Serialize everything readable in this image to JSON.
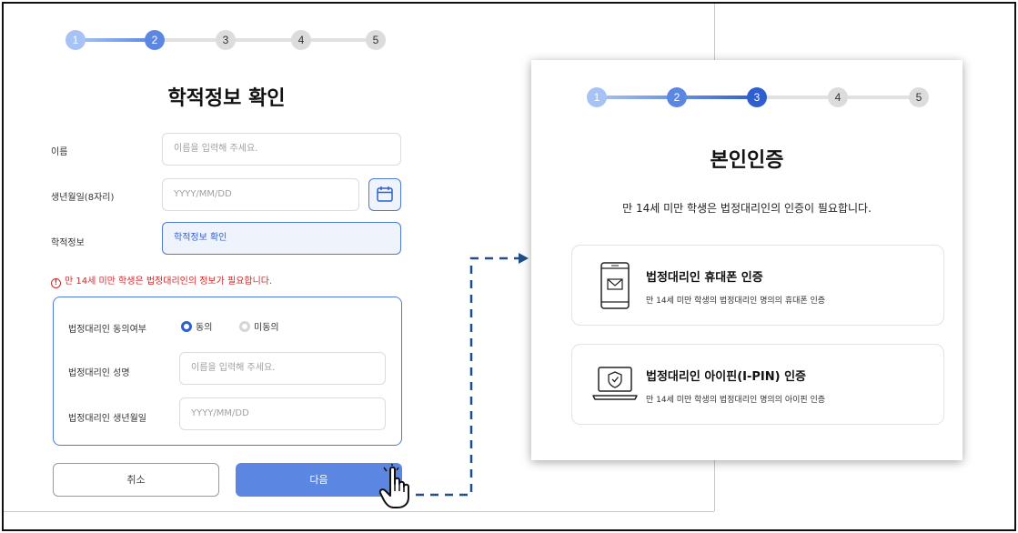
{
  "left_form": {
    "steps": [
      "1",
      "2",
      "3",
      "4",
      "5"
    ],
    "title": "학적정보 확인",
    "name_label": "이름",
    "name_placeholder": "이름을 입력해 주세요.",
    "birth_label": "생년월일(8자리)",
    "birth_placeholder": "YYYY/MM/DD",
    "school_label": "학적정보",
    "school_button": "학적정보 확인",
    "warning": "만 14세 미만 학생은 법정대리인의 정보가 필요합니다.",
    "guardian": {
      "consent_label": "법정대리인 동의여부",
      "agree_label": "동의",
      "disagree_label": "미동의",
      "name_label": "법정대리인 성명",
      "name_placeholder": "이름을 입력해 주세요.",
      "birth_label": "법정대리인 생년월일",
      "birth_placeholder": "YYYY/MM/DD"
    },
    "cancel_label": "취소",
    "next_label": "다음"
  },
  "right_panel": {
    "steps": [
      "1",
      "2",
      "3",
      "4",
      "5"
    ],
    "title": "본인인증",
    "subtitle": "만 14세 미만 학생은 법정대리인의 인증이 필요합니다.",
    "phone_card": {
      "title": "법정대리인 휴대폰 인증",
      "desc": "만 14세 미만 학생의 법정대리인 명의의 휴대폰 인증"
    },
    "ipin_card": {
      "title": "법정대리인 아이핀(I-PIN) 인증",
      "desc": "만 14세 미만 학생의 법정대리인 명의의 아이핀 인증"
    }
  },
  "colors": {
    "accent": "#2f5fcf",
    "accent_light": "#5b87e3",
    "warning": "#d0282b"
  }
}
